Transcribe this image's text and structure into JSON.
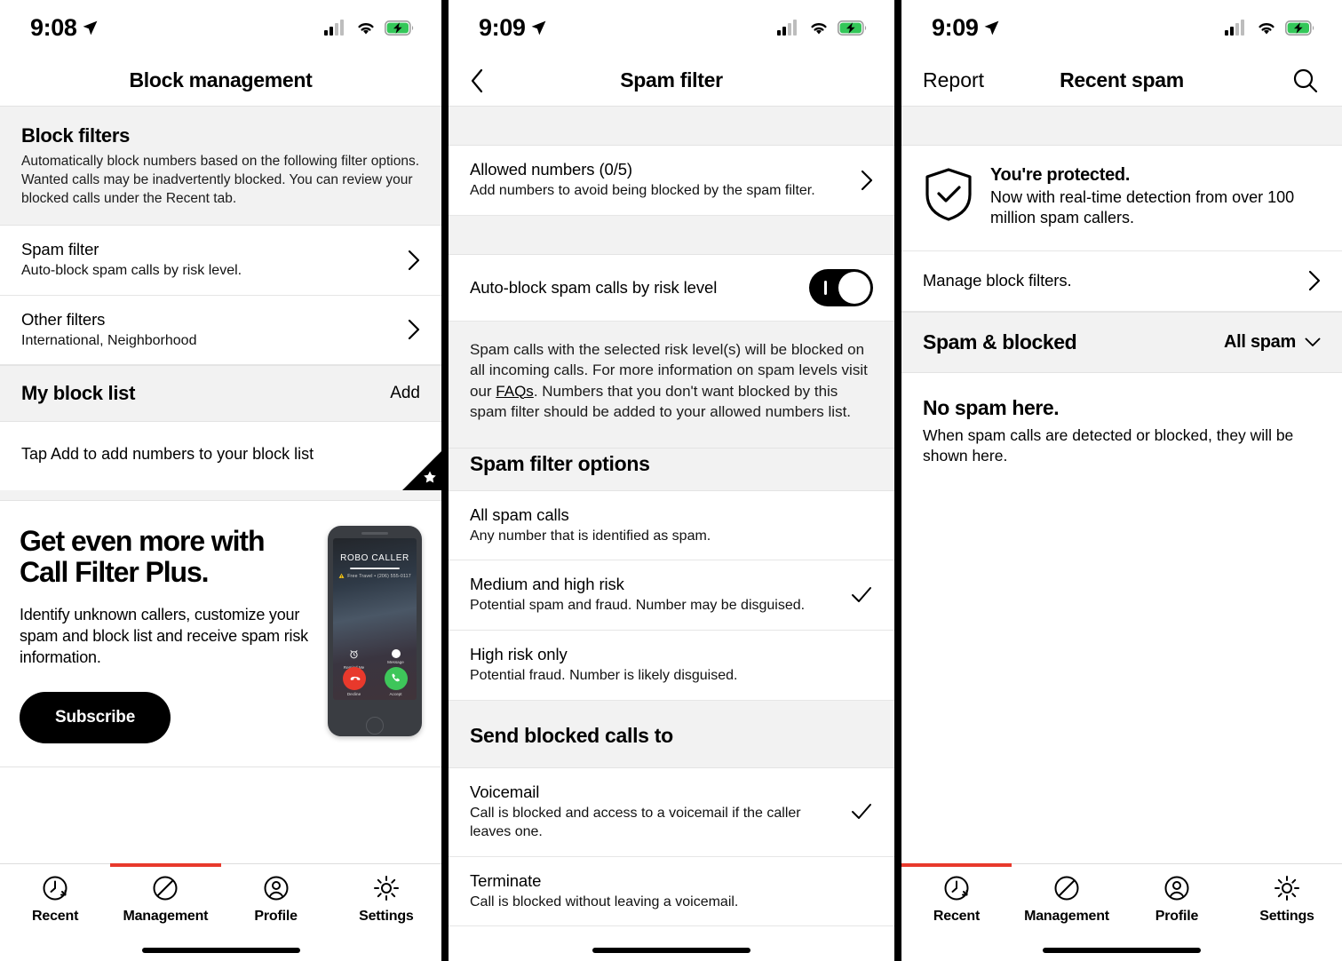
{
  "screens": [
    {
      "status": {
        "time": "9:08",
        "location_icon": "location-arrow-icon",
        "signal_icon": "cellular-signal-icon",
        "wifi_icon": "wifi-icon",
        "battery_icon": "battery-charging-icon"
      },
      "nav": {
        "title": "Block management"
      },
      "block_filters": {
        "heading": "Block filters",
        "description": "Automatically block numbers based on the following filter options. Wanted calls may be inadvertently blocked. You can review your blocked calls under the Recent tab.",
        "rows": [
          {
            "title": "Spam filter",
            "subtitle": "Auto-block spam calls by risk level.",
            "accessory": "chevron-right-icon"
          },
          {
            "title": "Other filters",
            "subtitle": "International, Neighborhood",
            "accessory": "chevron-right-icon"
          }
        ]
      },
      "block_list": {
        "heading": "My block list",
        "action": "Add",
        "empty_text": "Tap Add to add numbers to your block list",
        "badge_icon": "star-icon"
      },
      "promo": {
        "heading": "Get even more with Call Filter Plus.",
        "body": "Identify unknown callers, customize your spam and block list and receive spam risk information.",
        "button": "Subscribe",
        "mock": {
          "caller": "ROBO CALLER",
          "meta_warning_icon": "warning-triangle-icon",
          "meta": "Free Travel  •  (206) 555-0117",
          "remind_label": "Remind Me",
          "message_label": "Message",
          "decline_label": "Decline",
          "accept_label": "Accept"
        }
      },
      "tabbar": {
        "active": "Management",
        "items": [
          {
            "label": "Recent",
            "icon": "clock-history-icon"
          },
          {
            "label": "Management",
            "icon": "block-circle-icon"
          },
          {
            "label": "Profile",
            "icon": "person-circle-icon"
          },
          {
            "label": "Settings",
            "icon": "gear-icon"
          }
        ]
      }
    },
    {
      "status": {
        "time": "9:09",
        "location_icon": "location-arrow-icon",
        "signal_icon": "cellular-signal-icon",
        "wifi_icon": "wifi-icon",
        "battery_icon": "battery-charging-icon"
      },
      "nav": {
        "title": "Spam filter",
        "back_icon": "chevron-left-icon"
      },
      "allowed": {
        "title": "Allowed numbers (0/5)",
        "subtitle": "Add numbers to avoid being blocked by the spam filter.",
        "accessory": "chevron-right-icon"
      },
      "autoblock": {
        "label": "Auto-block spam calls by risk level",
        "toggle_state": "on"
      },
      "description": {
        "part1": "Spam calls with the selected risk level(s) will be blocked on all incoming calls. For more information on spam levels visit our ",
        "link": "FAQs",
        "part2": ".  Numbers that you don't want blocked by this spam filter should be added to your allowed numbers list."
      },
      "options_heading": "Spam filter options",
      "options": [
        {
          "title": "All spam calls",
          "subtitle": "Any number that is identified as spam.",
          "selected": false
        },
        {
          "title": "Medium and high risk",
          "subtitle": "Potential spam and fraud. Number may be disguised.",
          "selected": true
        },
        {
          "title": "High risk only",
          "subtitle": "Potential fraud. Number is likely disguised.",
          "selected": false
        }
      ],
      "send_heading": "Send blocked calls to",
      "send_options": [
        {
          "title": "Voicemail",
          "subtitle": "Call is blocked and access to a voicemail if the caller leaves one.",
          "selected": true
        },
        {
          "title": "Terminate",
          "subtitle": "Call is blocked without leaving a voicemail.",
          "selected": false
        }
      ]
    },
    {
      "status": {
        "time": "9:09",
        "location_icon": "location-arrow-icon",
        "signal_icon": "cellular-signal-icon",
        "wifi_icon": "wifi-icon",
        "battery_icon": "battery-charging-icon"
      },
      "nav": {
        "left": "Report",
        "title": "Recent spam",
        "search_icon": "search-icon"
      },
      "protected": {
        "icon": "shield-check-icon",
        "heading": "You're protected.",
        "body": "Now with real-time detection from over 100 million spam callers."
      },
      "manage_row": {
        "title": "Manage block filters.",
        "accessory": "chevron-right-icon"
      },
      "spam_blocked": {
        "heading": "Spam & blocked",
        "filter_value": "All spam",
        "filter_icon": "chevron-down-icon"
      },
      "empty": {
        "heading": "No spam here.",
        "body": "When spam calls are detected or blocked, they will be shown here."
      },
      "tabbar": {
        "active": "Recent",
        "items": [
          {
            "label": "Recent",
            "icon": "clock-history-icon"
          },
          {
            "label": "Management",
            "icon": "block-circle-icon"
          },
          {
            "label": "Profile",
            "icon": "person-circle-icon"
          },
          {
            "label": "Settings",
            "icon": "gear-icon"
          }
        ]
      }
    }
  ],
  "colors": {
    "accent": "#e8392c",
    "section_bg": "#f2f2f2",
    "text": "#000000"
  }
}
